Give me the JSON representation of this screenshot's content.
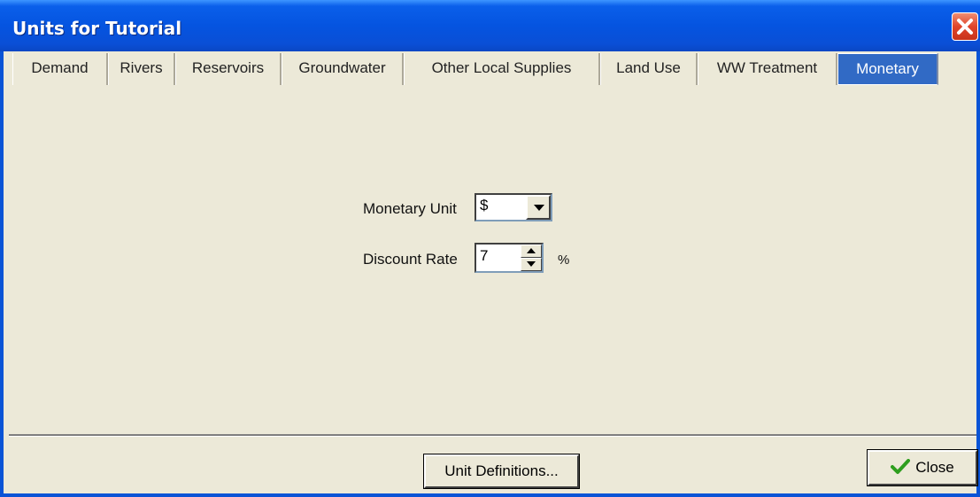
{
  "window": {
    "title": "Units for Tutorial"
  },
  "tabs": [
    {
      "label": "Demand",
      "active": false
    },
    {
      "label": "Rivers",
      "active": false
    },
    {
      "label": "Reservoirs",
      "active": false
    },
    {
      "label": "Groundwater",
      "active": false
    },
    {
      "label": "Other Local Supplies",
      "active": false
    },
    {
      "label": "Land Use",
      "active": false
    },
    {
      "label": "WW Treatment",
      "active": false
    },
    {
      "label": "Monetary",
      "active": true
    }
  ],
  "monetary": {
    "unit_label": "Monetary Unit",
    "unit_value": "$",
    "discount_label": "Discount Rate",
    "discount_value": "7",
    "discount_suffix": "%"
  },
  "footer": {
    "unit_definitions_label": "Unit Definitions...",
    "close_label": "Close"
  },
  "icons": {
    "close_window": "close-x-icon",
    "dropdown": "chevron-down-icon",
    "spin_up": "arrow-up-icon",
    "spin_down": "arrow-down-icon",
    "close_button": "checkmark-icon"
  },
  "colors": {
    "titlebar": "#0554e0",
    "active_tab": "#316ac5",
    "dialog_bg": "#ece9d8",
    "close_x": "#e0442a",
    "checkmark": "#2e9e1e"
  }
}
